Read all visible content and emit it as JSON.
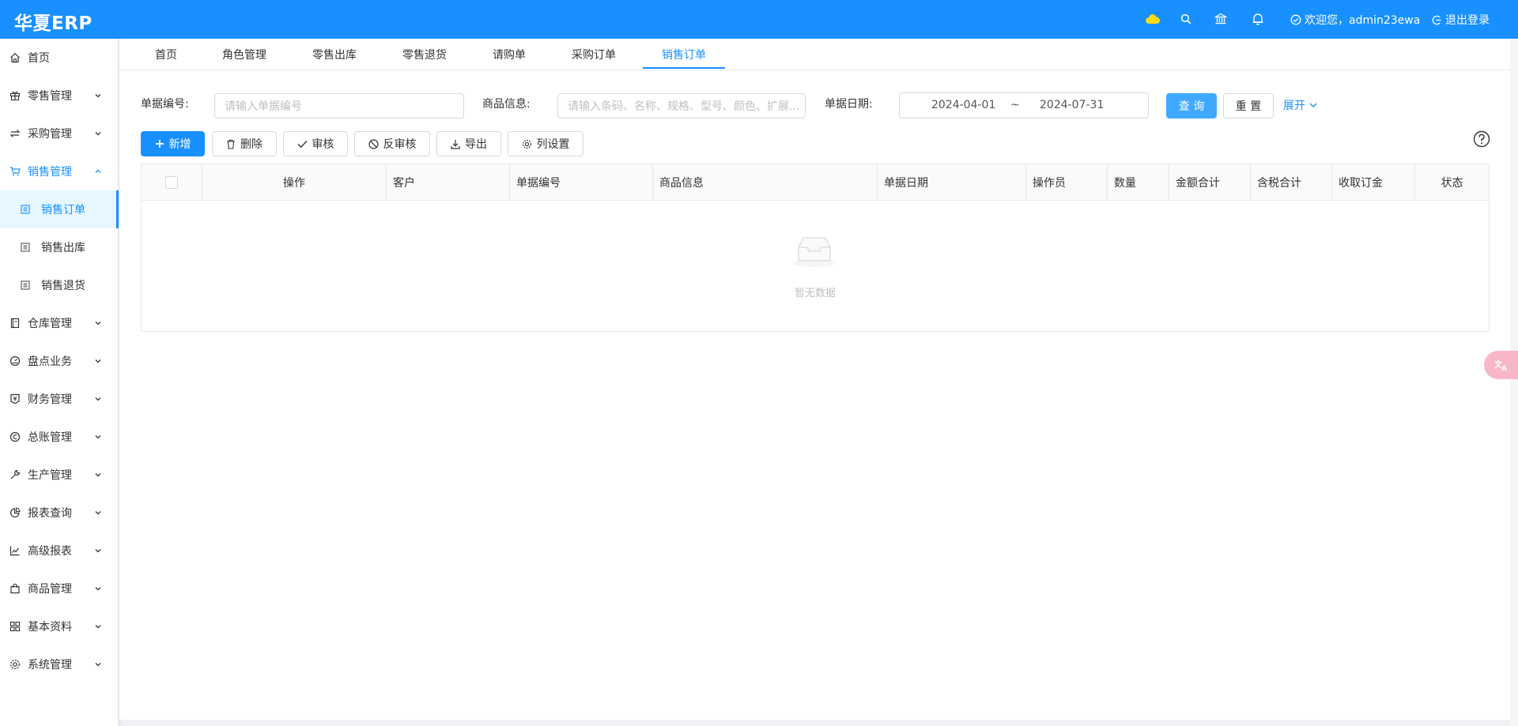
{
  "header": {
    "logo": "华夏ERP",
    "user_greeting": "欢迎您，admin23ewa",
    "logout_label": "退出登录"
  },
  "sidebar": {
    "items": [
      {
        "label": "首页",
        "icon": "home-icon"
      },
      {
        "label": "零售管理",
        "icon": "gift-icon"
      },
      {
        "label": "采购管理",
        "icon": "swap-icon"
      },
      {
        "label": "销售管理",
        "icon": "cart-icon"
      },
      {
        "label": "销售订单",
        "icon": "doc-icon"
      },
      {
        "label": "销售出库",
        "icon": "doc-icon"
      },
      {
        "label": "销售退货",
        "icon": "doc-icon"
      },
      {
        "label": "仓库管理",
        "icon": "book-icon"
      },
      {
        "label": "盘点业务",
        "icon": "dashboard-icon"
      },
      {
        "label": "财务管理",
        "icon": "money-icon"
      },
      {
        "label": "总账管理",
        "icon": "ledger-icon"
      },
      {
        "label": "生产管理",
        "icon": "tool-icon"
      },
      {
        "label": "报表查询",
        "icon": "pie-icon"
      },
      {
        "label": "高级报表",
        "icon": "line-chart-icon"
      },
      {
        "label": "商品管理",
        "icon": "shopping-icon"
      },
      {
        "label": "基本资料",
        "icon": "appstore-icon"
      },
      {
        "label": "系统管理",
        "icon": "setting-icon"
      }
    ]
  },
  "tabs": [
    "首页",
    "角色管理",
    "零售出库",
    "零售退货",
    "请购单",
    "采购订单",
    "销售订单"
  ],
  "filters": {
    "bill_no_label": "单据编号:",
    "bill_no_placeholder": "请输入单据编号",
    "goods_label": "商品信息:",
    "goods_placeholder": "请输入条码、名称、规格、型号、颜色、扩展...",
    "date_label": "单据日期:",
    "date_start": "2024-04-01",
    "date_sep": "~",
    "date_end": "2024-07-31",
    "query_label": "查 询",
    "reset_label": "重 置",
    "expand_label": "展开"
  },
  "toolbar": {
    "add_label": "新增",
    "delete_label": "删除",
    "audit_label": "审核",
    "unaudit_label": "反审核",
    "export_label": "导出",
    "columns_label": "列设置"
  },
  "table": {
    "columns": [
      "操作",
      "客户",
      "单据编号",
      "商品信息",
      "单据日期",
      "操作员",
      "数量",
      "金额合计",
      "含税合计",
      "收取订金",
      "状态"
    ],
    "empty_text": "暂无数据"
  },
  "colors": {
    "primary": "#1890ff",
    "query": "#40a9ff",
    "translate_badge": "#f8b7c9"
  }
}
